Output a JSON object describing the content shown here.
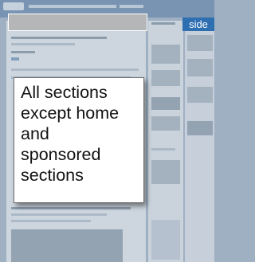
{
  "callout": {
    "lines": [
      "All sections",
      "except home",
      "and",
      "sponsored",
      "sections"
    ]
  },
  "side_tab": {
    "label": "side"
  },
  "colors": {
    "callout_bg": "#ffffff",
    "side_tab_bg": "#2d6fb0",
    "search_bar_bg": "#b4b6b8",
    "page_bg": "#9eb0c2"
  }
}
